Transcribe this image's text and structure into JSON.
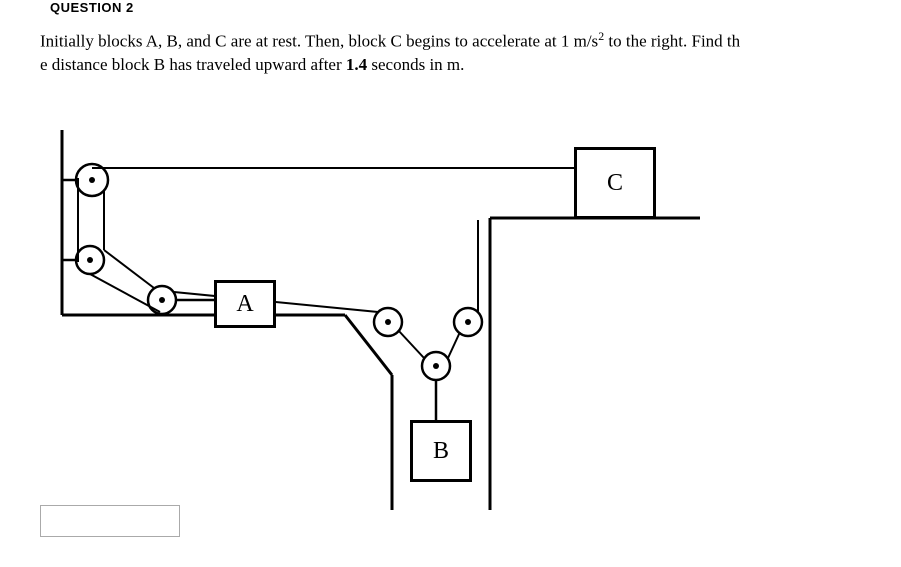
{
  "header": "QUESTION 2",
  "problem": {
    "line1_part1": "Initially blocks A, B, and C are at rest.  Then, block C begins to accelerate at 1 m/s",
    "line1_sup": "2",
    "line1_part2": " to the right.  Find th",
    "line2_part1": "e distance block B has traveled upward after ",
    "line2_bold": "1.4",
    "line2_part2": " seconds in m."
  },
  "labels": {
    "a": "A",
    "b": "B",
    "c": "C"
  },
  "answer": ""
}
